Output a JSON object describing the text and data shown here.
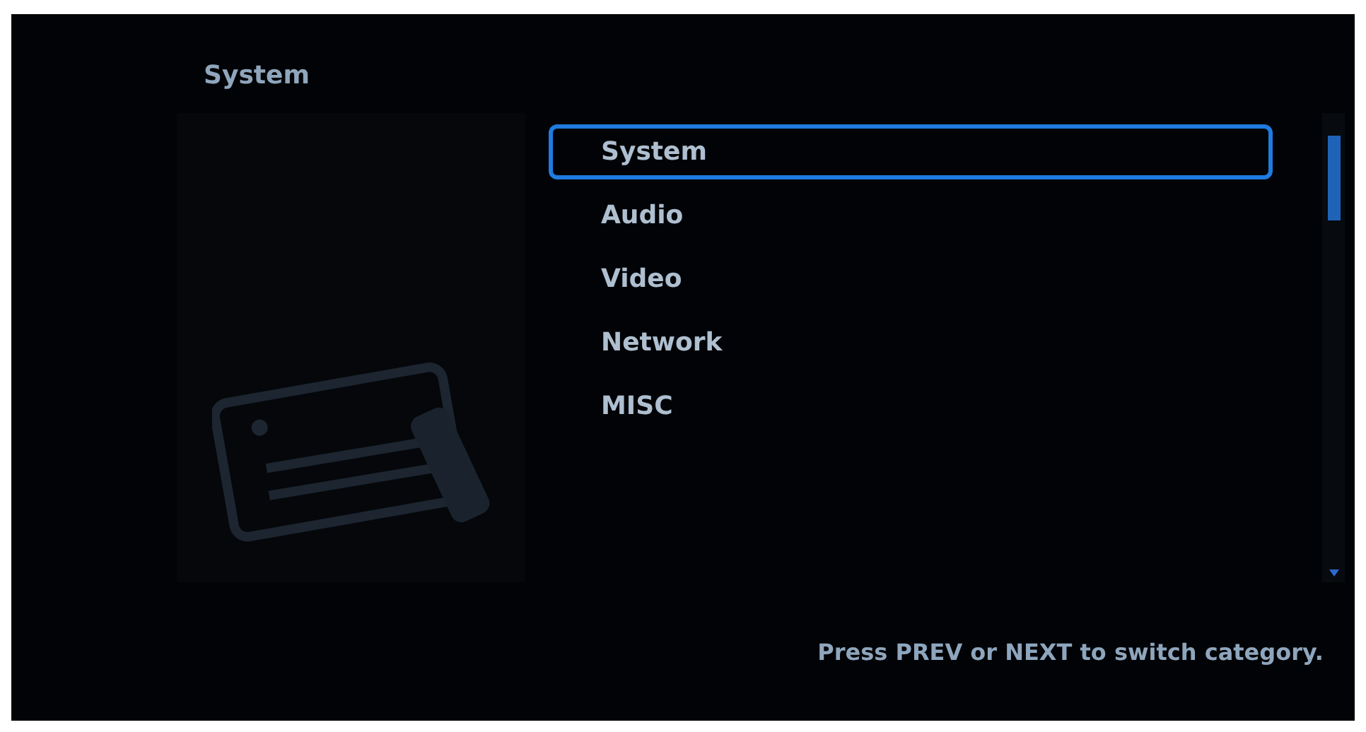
{
  "title": "System",
  "menu": [
    {
      "label": "System",
      "selected": true
    },
    {
      "label": "Audio",
      "selected": false
    },
    {
      "label": "Video",
      "selected": false
    },
    {
      "label": "Network",
      "selected": false
    },
    {
      "label": "MISC",
      "selected": false
    }
  ],
  "hint": "Press PREV or NEXT to switch category."
}
